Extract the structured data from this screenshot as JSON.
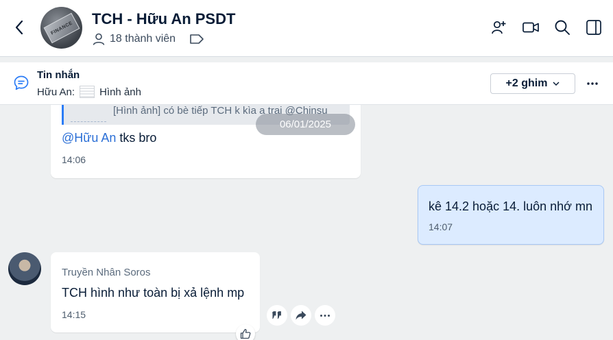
{
  "header": {
    "title": "TCH - Hữu An PSDT",
    "avatar_text": "FINANCE",
    "members_label": "18 thành viên",
    "icons": [
      "back-icon",
      "add-user-icon",
      "video-call-icon",
      "search-icon",
      "sidebar-toggle-icon"
    ]
  },
  "pinned": {
    "title": "Tin nhắn",
    "sender": "Hữu An:",
    "preview": "Hình ảnh",
    "ghim_label": "+2 ghim"
  },
  "messages": [
    {
      "quote_text": "[Hình ảnh] có bè tiếp TCH k kìa a trai @Chinsu",
      "mention": "@Hữu An",
      "text": " tks bro",
      "time": "14:06"
    },
    {
      "text": "kê 14.2 hoặc 14. luôn nhớ mn",
      "time": "14:07"
    },
    {
      "sender": "Truyền Nhân Soros",
      "text": "TCH hình như toàn bị xả lệnh mp",
      "time": "14:15"
    }
  ],
  "date_separator": "06/01/2025",
  "colors": {
    "accent": "#2b7cf6",
    "own_bubble": "#dcebff",
    "background": "#eef0f1"
  }
}
